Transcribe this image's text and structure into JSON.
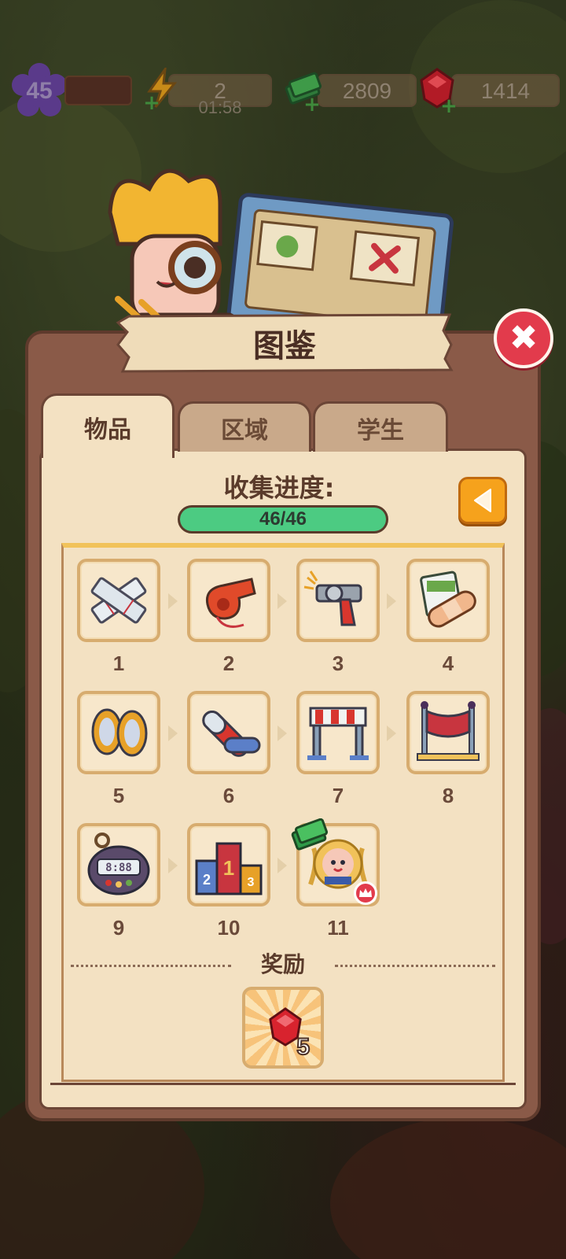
{
  "hud": {
    "level": "45",
    "energy": {
      "value": "2",
      "timer": "01:58",
      "icon": "lightning-icon"
    },
    "cash": {
      "value": "2809",
      "icon": "cash-stack-icon"
    },
    "gems": {
      "value": "1414",
      "icon": "red-gem-icon"
    },
    "plus_glyph": "+"
  },
  "panel": {
    "title": "图鉴",
    "close_glyph": "✖",
    "tabs": [
      {
        "label": "物品",
        "active": true
      },
      {
        "label": "区域",
        "active": false
      },
      {
        "label": "学生",
        "active": false
      }
    ],
    "progress": {
      "label": "收集进度:",
      "text": "46/46",
      "fraction": 1.0
    },
    "items": [
      {
        "number": "1",
        "icon": "bandage-strips-icon"
      },
      {
        "number": "2",
        "icon": "whistle-icon"
      },
      {
        "number": "3",
        "icon": "starter-pistol-icon"
      },
      {
        "number": "4",
        "icon": "first-aid-bandage-icon"
      },
      {
        "number": "5",
        "icon": "sneakers-icon"
      },
      {
        "number": "6",
        "icon": "relay-baton-icon"
      },
      {
        "number": "7",
        "icon": "hurdle-icon"
      },
      {
        "number": "8",
        "icon": "finish-line-icon"
      },
      {
        "number": "9",
        "icon": "stopwatch-icon"
      },
      {
        "number": "10",
        "icon": "podium-icon"
      },
      {
        "number": "11",
        "icon": "champion-medal-icon"
      }
    ],
    "podium_digits": [
      "1",
      "2",
      "3"
    ],
    "stopwatch_display": "8:88",
    "reward": {
      "label": "奖励",
      "amount": "5",
      "icon": "red-gem-icon"
    }
  },
  "colors": {
    "accent_orange": "#f6a21c",
    "progress_green": "#4ccb82",
    "close_red": "#e23b4c",
    "panel_brown": "#8a5a48",
    "card_cream": "#f3e1c2"
  }
}
